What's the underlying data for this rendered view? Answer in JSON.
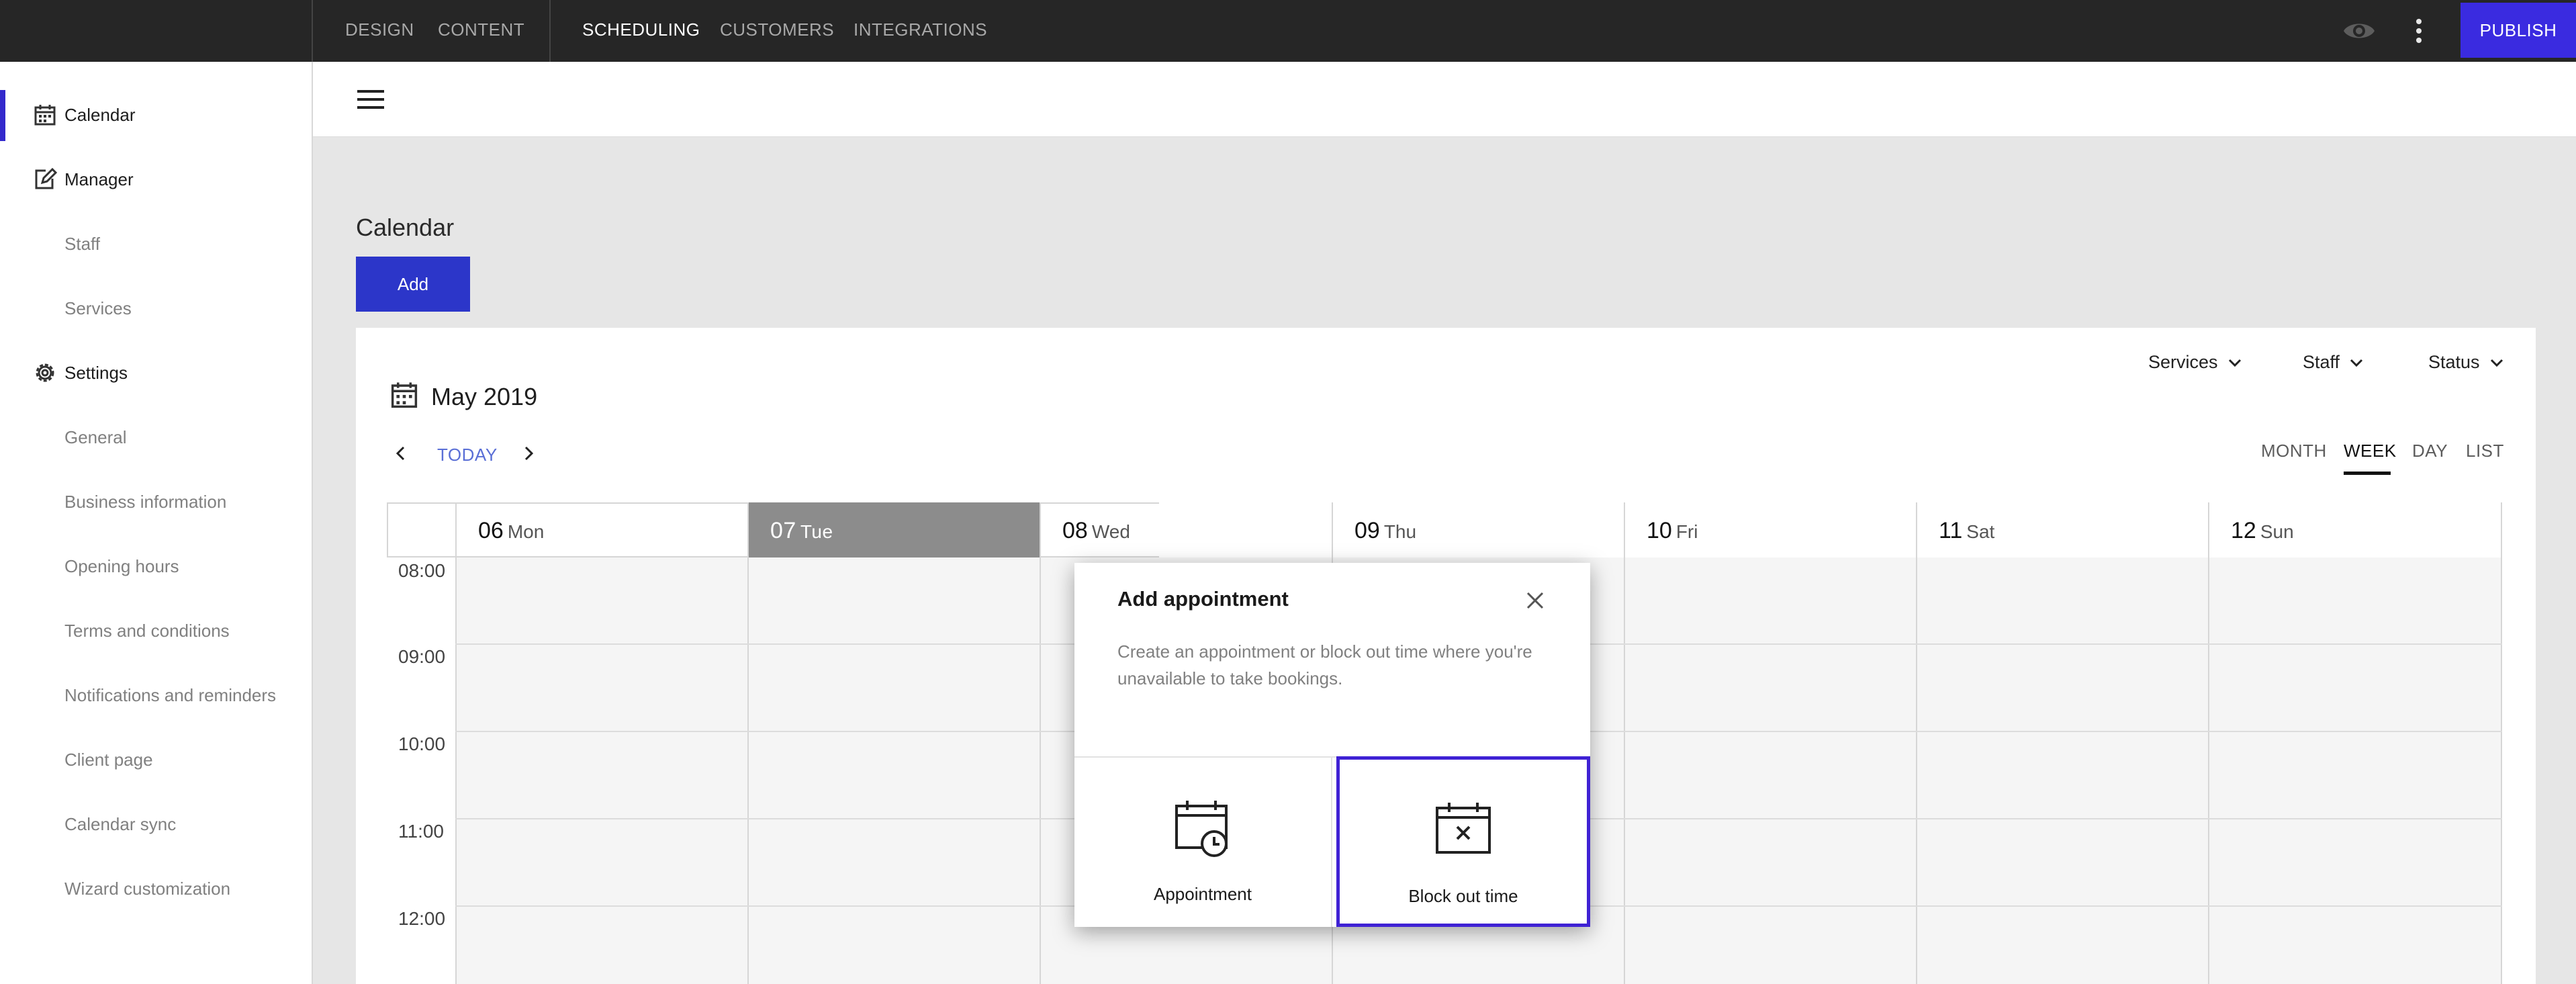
{
  "topbar": {
    "nav": [
      "DESIGN",
      "CONTENT",
      "SCHEDULING",
      "CUSTOMERS",
      "INTEGRATIONS"
    ],
    "active": "SCHEDULING",
    "publish_label": "PUBLISH",
    "icons": [
      "eye-icon",
      "more-vert-icon"
    ]
  },
  "sidebar": {
    "items": [
      {
        "label": "Calendar",
        "icon": "calendar-icon",
        "active": true
      },
      {
        "label": "Manager",
        "icon": "edit-icon"
      },
      {
        "label": "Staff"
      },
      {
        "label": "Services"
      },
      {
        "label": "Settings",
        "icon": "gear-icon"
      },
      {
        "label": "General"
      },
      {
        "label": "Business information"
      },
      {
        "label": "Opening hours"
      },
      {
        "label": "Terms and conditions"
      },
      {
        "label": "Notifications and reminders"
      },
      {
        "label": "Client page"
      },
      {
        "label": "Calendar sync"
      },
      {
        "label": "Wizard customization"
      }
    ]
  },
  "main": {
    "title": "Calendar",
    "add_label": "Add",
    "month_label": "May 2019",
    "today_label": "TODAY",
    "filters": [
      "Services",
      "Staff",
      "Status"
    ],
    "views": [
      "MONTH",
      "WEEK",
      "DAY",
      "LIST"
    ],
    "active_view": "WEEK",
    "days": [
      {
        "num": "06",
        "name": "Mon"
      },
      {
        "num": "07",
        "name": "Tue",
        "today": true
      },
      {
        "num": "08",
        "name": "Wed"
      },
      {
        "num": "09",
        "name": "Thu"
      },
      {
        "num": "10",
        "name": "Fri"
      },
      {
        "num": "11",
        "name": "Sat"
      },
      {
        "num": "12",
        "name": "Sun"
      }
    ],
    "times": [
      "08:00",
      "09:00",
      "10:00",
      "11:00",
      "12:00"
    ]
  },
  "modal": {
    "title": "Add appointment",
    "description": "Create an appointment or block out time where you're unavailable to take bookings.",
    "options": [
      {
        "label": "Appointment",
        "icon": "calendar-clock-icon"
      },
      {
        "label": "Block out time",
        "icon": "calendar-x-icon",
        "selected": true
      }
    ],
    "accent_color": "#3f22d4"
  },
  "colors": {
    "topbar_bg": "#262626",
    "primary": "#2c36c9",
    "publish": "#3a2be0"
  }
}
